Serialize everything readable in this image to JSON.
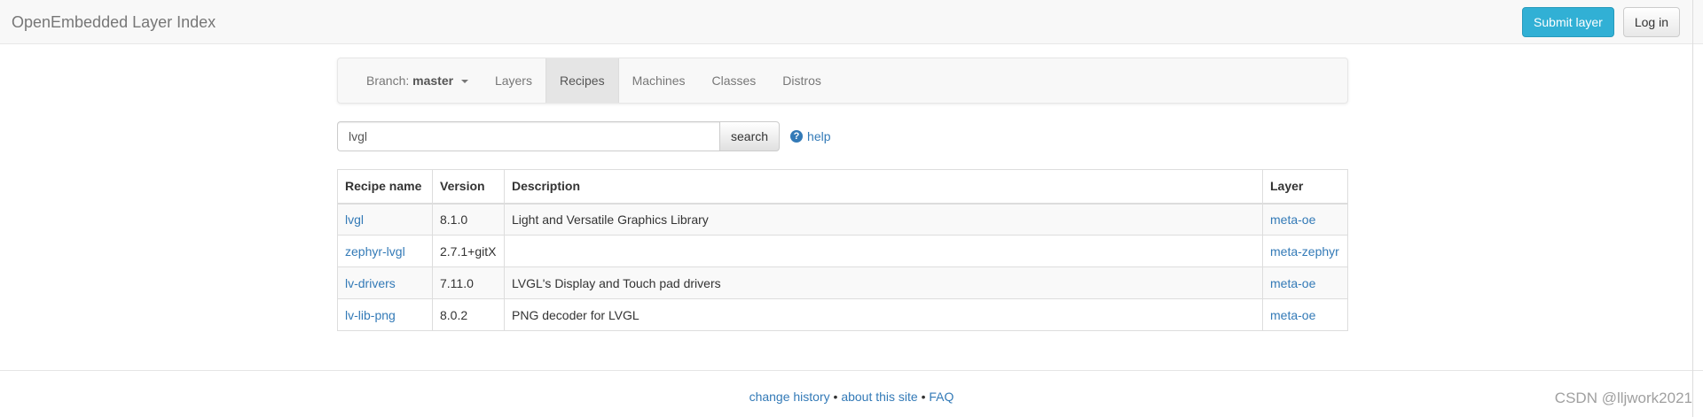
{
  "navbar": {
    "brand": "OpenEmbedded Layer Index",
    "submit_label": "Submit layer",
    "login_label": "Log in"
  },
  "subnav": {
    "branch_prefix": "Branch:",
    "branch_value": "master",
    "items": [
      {
        "label": "Layers",
        "active": false
      },
      {
        "label": "Recipes",
        "active": true
      },
      {
        "label": "Machines",
        "active": false
      },
      {
        "label": "Classes",
        "active": false
      },
      {
        "label": "Distros",
        "active": false
      }
    ]
  },
  "search": {
    "value": "lvgl",
    "button_label": "search",
    "help_label": "help"
  },
  "table": {
    "headers": [
      "Recipe name",
      "Version",
      "Description",
      "Layer"
    ],
    "rows": [
      {
        "name": "lvgl",
        "version": "8.1.0",
        "description": "Light and Versatile Graphics Library",
        "layer": "meta-oe"
      },
      {
        "name": "zephyr-lvgl",
        "version": "2.7.1+gitX",
        "description": "",
        "layer": "meta-zephyr"
      },
      {
        "name": "lv-drivers",
        "version": "7.11.0",
        "description": "LVGL's Display and Touch pad drivers",
        "layer": "meta-oe"
      },
      {
        "name": "lv-lib-png",
        "version": "8.0.2",
        "description": "PNG decoder for LVGL",
        "layer": "meta-oe"
      }
    ]
  },
  "footer": {
    "change_history": "change history",
    "about": "about this site",
    "faq": "FAQ",
    "separator": " • "
  },
  "watermark": "CSDN @lljwork2021",
  "icons": {
    "help": "question-circle-icon",
    "branch_caret": "caret-down-icon"
  },
  "colors": {
    "link": "#337ab7",
    "primary_button": "#31b0d5",
    "navbar_bg": "#f8f8f8",
    "active_tab_bg": "#e5e5e5"
  }
}
